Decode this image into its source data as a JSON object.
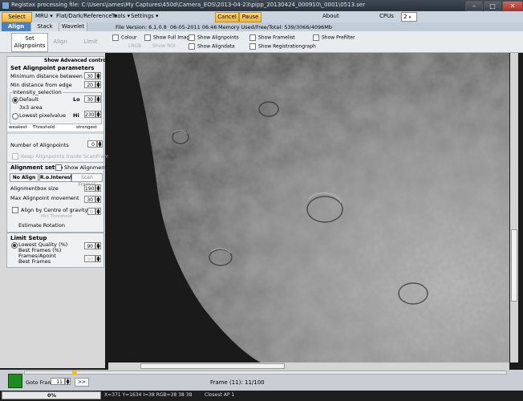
{
  "window": {
    "title": "Registax processing file: C:\\Users\\james\\My Captures\\450d\\Camera_EOS\\2013-04-23\\pipp_20130424_000910\\_0001\\0513.ser"
  },
  "menubar": {
    "select": "Select",
    "mru": "MRU",
    "flat": "Flat/Dark/Reference",
    "tools": "Tools",
    "settings": "Settings",
    "cancel": "Cancel",
    "pause": "Pause",
    "about": "About",
    "cpus_label": "CPUs",
    "cpus_value": "2"
  },
  "tabs": {
    "align": "Align",
    "stack": "Stack",
    "wavelet": "Wavelet",
    "file_version": "File Version: 6.1.0.8",
    "date": "06-05-2011 06:46",
    "memory": "Memory Used/Free/Total: 539/3066/4096Mb"
  },
  "options": {
    "set_alignpoints": "Set Alignpoints",
    "align": "Align",
    "limit": "Limit",
    "colour": "Colour",
    "lrgb": "LRGB",
    "show_full_image": "Show Full Image",
    "show_roi": "Show ROI",
    "show_alignpoints": "Show Alignpoints",
    "show_aligndata": "Show Aligndata",
    "show_framelist": "Show Framelist",
    "show_registrationgraph": "Show Registrationgraph",
    "show_prefilter": "Show Prefilter"
  },
  "left": {
    "show_advanced": "Show Advanced controls",
    "set_params_title": "Set Alignpoint parameters",
    "min_distance_between": "Minimum distance between",
    "min_distance_between_val": "30",
    "min_distance_edge": "Min distance from edge",
    "min_distance_edge_val": "20",
    "intensity_selection": "Intensity_selection",
    "default": "Default",
    "lo": "Lo",
    "lo_val": "30",
    "area3x3": "3x3 area",
    "lowest_pixel": "Lowest pixelvalue",
    "hi": "Hi",
    "hi_val": "230",
    "weakest": "weakest",
    "threshold": "Threshold",
    "strongest": "strongest",
    "num_alignpoints": "Number of Alignpoints",
    "num_alignpoints_val": "0",
    "keep_alignpoints": "Keep Alignpoints inside ScanFrame",
    "alignment_setup": "Alignment setup",
    "show_alignment": "Show Alignment",
    "no_align": "No Align",
    "ro_interest": "R.o.Interest",
    "scan_frames": "Scan Frames",
    "alignmentbox_size": "Alignmentbox size",
    "alignmentbox_val": "190",
    "max_movement": "Max Alignpoint movement",
    "max_movement_val": "30",
    "align_centre": "Align by Centre of gravity",
    "align_centre_val": "0",
    "min_threshold": "Min Threshold",
    "estimate_rotation": "Estimate Rotation",
    "limit_setup": "Limit Setup",
    "lowest_quality": "Lowest Quality (%)",
    "lowest_quality_val": "90",
    "best_frames_pct": "Best Frames (%)",
    "frames_apoint": "Frames/Apoint",
    "best_frames": "Best Frames",
    "best_frames_val": "50"
  },
  "bottom": {
    "goto_frame": "Goto Frame",
    "goto_frame_val": "11",
    "goto_btn": ">>",
    "frame_info": "Frame (11): 11/100"
  },
  "status": {
    "progress": "0%",
    "progress_value": 0,
    "coords": "X=371 Y=1634 I=38 RGB=38 38 38",
    "closest": "Closest AP 1"
  },
  "colors": {
    "accent": "#4a7fc0",
    "orange": "#f0b43c",
    "green": "#1f8a1f"
  }
}
